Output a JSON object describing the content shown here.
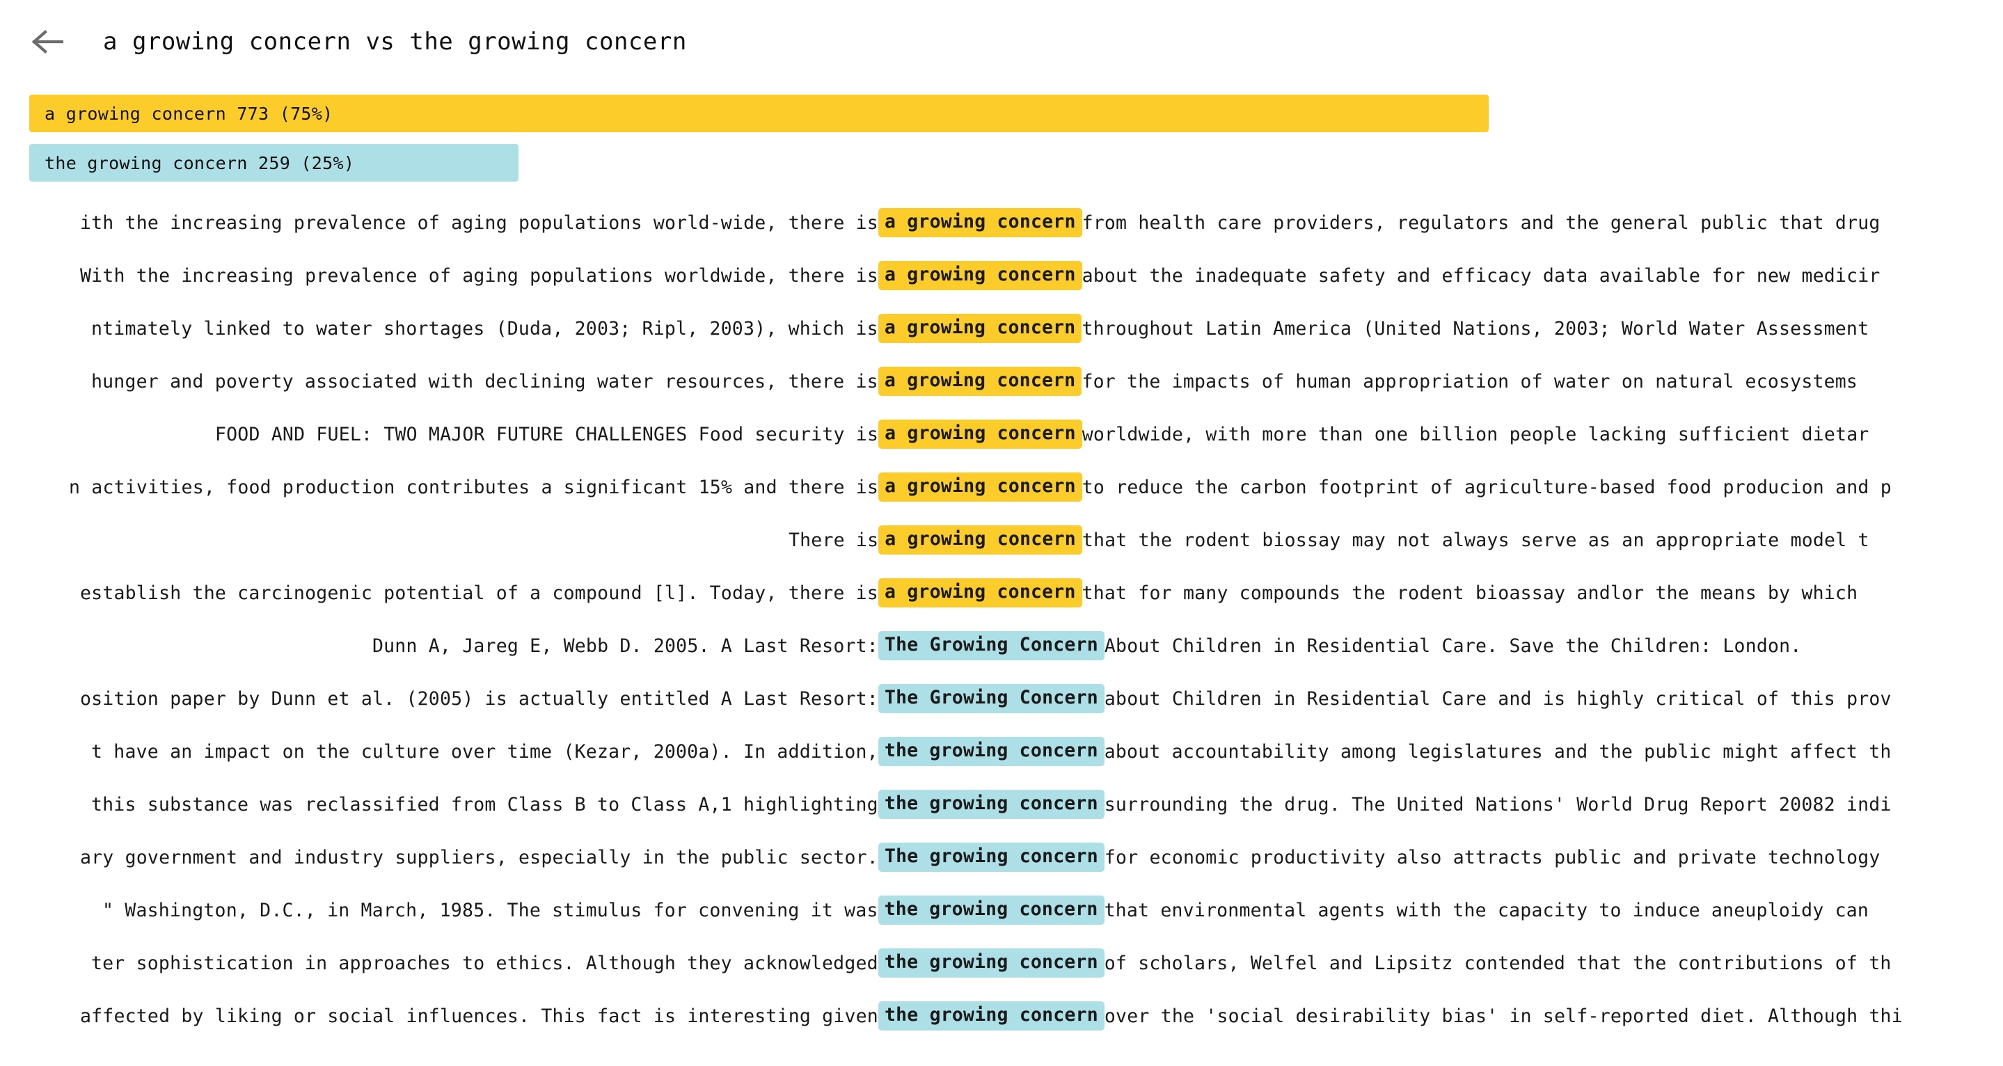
{
  "header": {
    "back_icon": "arrow-left-icon",
    "title": "a growing concern vs the growing concern"
  },
  "comparison_bars": [
    {
      "label": "a growing concern 773 (75%)",
      "term": "a growing concern",
      "count": 773,
      "percent": 75,
      "color": "#fccd2a"
    },
    {
      "label": "the growing concern 259 (25%)",
      "term": "the growing concern",
      "count": 259,
      "percent": 25,
      "color": "#addfe6"
    }
  ],
  "chart_data": {
    "type": "bar",
    "title": "a growing concern vs the growing concern",
    "categories": [
      "a growing concern",
      "the growing concern"
    ],
    "values": [
      773,
      259
    ],
    "percents": [
      75,
      25
    ],
    "colors": [
      "#fccd2a",
      "#addfe6"
    ],
    "orientation": "horizontal",
    "xlabel": "",
    "ylabel": "",
    "grid": false,
    "legend": "none"
  },
  "concordance": [
    {
      "left": "ith the increasing prevalence of aging populations world-wide, there is ",
      "keyword": "a growing concern",
      "right": " from health care providers, regulators and the general public that drug",
      "variant": "a"
    },
    {
      "left": "With the increasing prevalence of aging populations worldwide, there is ",
      "keyword": "a growing concern",
      "right": " about the inadequate safety and efficacy data available for new medicir",
      "variant": "a"
    },
    {
      "left": "ntimately linked to water shortages (Duda, 2003; Ripl, 2003), which is ",
      "keyword": "a growing concern",
      "right": " throughout Latin America (United Nations, 2003; World Water Assessment",
      "variant": "a"
    },
    {
      "left": " hunger and poverty associated with declining water resources, there is ",
      "keyword": "a growing concern",
      "right": " for the impacts of human appropriation of water on natural ecosystems",
      "variant": "a"
    },
    {
      "left": "FOOD AND FUEL: TWO MAJOR FUTURE CHALLENGES Food security is ",
      "keyword": "a growing concern",
      "right": " worldwide, with more than one billion people lacking sufficient dietar",
      "variant": "a"
    },
    {
      "left": "n activities, food production contributes a significant 15% and there is ",
      "keyword": "a growing concern",
      "right": " to reduce the carbon footprint of agriculture-based food producion and p",
      "variant": "a"
    },
    {
      "left": "There is ",
      "keyword": "a growing concern",
      "right": " that the rodent biossay may not always serve as an appropriate model t",
      "variant": "a"
    },
    {
      "left": "establish the carcinogenic potential of a compound [l]. Today, there is ",
      "keyword": "a growing concern",
      "right": " that for many compounds the rodent bioassay andlor the means by which",
      "variant": "a"
    },
    {
      "left": "Dunn A, Jareg E, Webb D. 2005. A Last Resort: ",
      "keyword": "The Growing Concern",
      "right": " About Children in Residential Care. Save the Children: London.",
      "variant": "b"
    },
    {
      "left": "osition paper by Dunn et al. (2005) is actually entitled A Last Resort: ",
      "keyword": "The Growing Concern",
      "right": " about Children in Residential Care and is highly critical of this prov",
      "variant": "b"
    },
    {
      "left": "t have an impact on the culture over time (Kezar, 2000a). In addition,",
      "keyword": "the growing concern",
      "right": " about accountability among legislatures and the public might affect th",
      "variant": "b"
    },
    {
      "left": "this substance was reclassified from Class B to Class A,1 highlighting ",
      "keyword": "the growing concern",
      "right": " surrounding the drug. The United Nations' World Drug Report 20082 indi",
      "variant": "b"
    },
    {
      "left": "ary government and industry suppliers, especially in the public sector. ",
      "keyword": "The growing concern",
      "right": " for economic productivity also attracts public and private technology",
      "variant": "b"
    },
    {
      "left": "\" Washington, D.C., in March, 1985. The stimulus for convening it was ",
      "keyword": "the growing concern",
      "right": " that environmental agents with the capacity to induce aneuploidy can",
      "variant": "b"
    },
    {
      "left": "ter sophistication in approaches to ethics. Although they acknowledged ",
      "keyword": "the growing concern",
      "right": " of scholars, Welfel and Lipsitz contended that the contributions of th",
      "variant": "b"
    },
    {
      "left": "affected by liking or social influences. This fact is interesting given ",
      "keyword": "the growing concern",
      "right": " over the 'social desirability bias' in self-reported diet. Although thi",
      "variant": "b"
    }
  ]
}
